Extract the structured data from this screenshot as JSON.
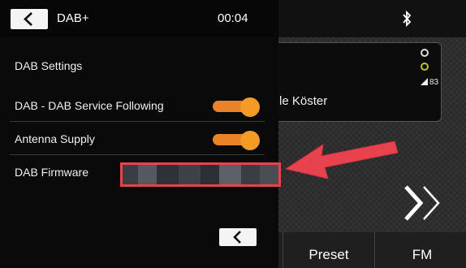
{
  "header": {
    "title": "DAB+",
    "time": "00:04"
  },
  "settings": {
    "section_title": "DAB Settings",
    "rows": [
      {
        "label": "DAB - DAB Service Following",
        "control": "toggle",
        "state": "on"
      },
      {
        "label": "Antenna Supply",
        "control": "toggle",
        "state": "on"
      },
      {
        "label": "DAB Firmware",
        "control": "obscured-value"
      }
    ]
  },
  "background": {
    "station_text": "le Köster",
    "signal_strength": "83",
    "bottom_buttons": {
      "preset": "Preset",
      "fm": "FM"
    }
  },
  "icons": {
    "back": "back-arrow-icon",
    "bluetooth": "bluetooth-icon",
    "next": "next-chevrons-icon",
    "signal": "signal-strength-icon"
  },
  "colors": {
    "toggle_on": "#f59a24",
    "highlight": "#e8424d",
    "annotation_arrow": "#e8424d"
  }
}
